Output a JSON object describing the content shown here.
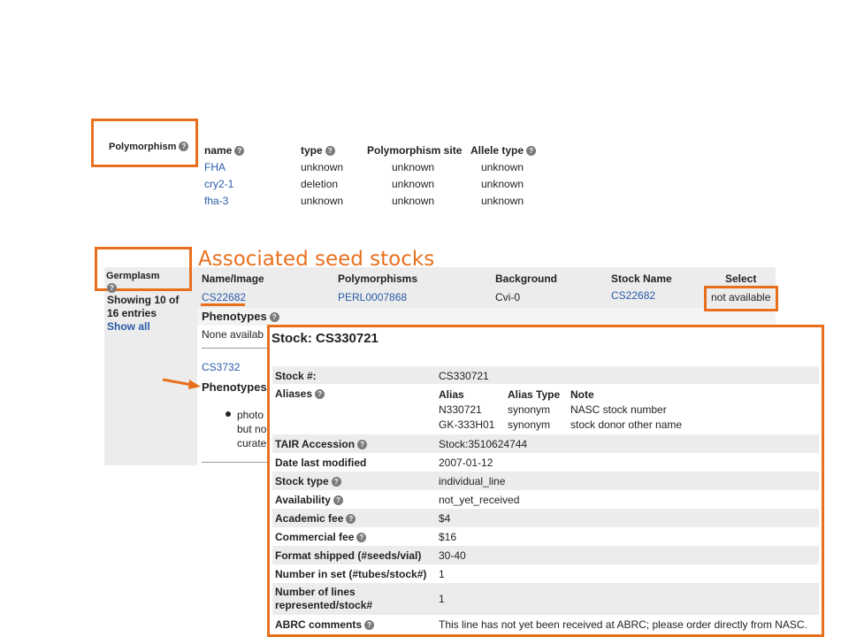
{
  "polymorphism": {
    "section_label": "Polymorphism",
    "headers": [
      "name",
      "type",
      "Polymorphism site",
      "Allele type"
    ],
    "rows": [
      {
        "name": "FHA",
        "type": "unknown",
        "site": "unknown",
        "allele": "unknown"
      },
      {
        "name": "cry2-1",
        "type": "deletion",
        "site": "unknown",
        "allele": "unknown"
      },
      {
        "name": "fha-3",
        "type": "unknown",
        "site": "unknown",
        "allele": "unknown"
      }
    ]
  },
  "annotation": {
    "associated_label": "Associated seed stocks"
  },
  "germplasm": {
    "section_label": "Germplasm",
    "showing_text": "Showing 10 of 16 entries",
    "show_all": "Show all",
    "headers": [
      "Name/Image",
      "Polymorphisms",
      "Background",
      "Stock Name",
      "Select"
    ],
    "row1": {
      "name": "CS22682",
      "polymorphism": "PERL0007868",
      "background": "Cvi-0",
      "stock_name": "CS22682",
      "select": "not available"
    },
    "phenotypes_label": "Phenotypes",
    "none_text": "None availab",
    "row2_name": "CS3732",
    "phenotypes_label2": "Phenotypes",
    "bullet_lines": [
      "photo",
      "but no",
      "curate"
    ]
  },
  "stock_popup": {
    "title": "Stock: CS330721",
    "rows": [
      {
        "label": "Stock #:",
        "value": "CS330721"
      },
      {
        "label": "Aliases",
        "value": ""
      },
      {
        "label": "TAIR Accession",
        "value": "Stock:3510624744"
      },
      {
        "label": "Date last modified",
        "value": "2007-01-12"
      },
      {
        "label": "Stock type",
        "value": "individual_line"
      },
      {
        "label": "Availability",
        "value": "not_yet_received"
      },
      {
        "label": "Academic fee",
        "value": "$4"
      },
      {
        "label": "Commercial fee",
        "value": "$16"
      },
      {
        "label": "Format shipped (#seeds/vial)",
        "value": "30-40"
      },
      {
        "label": "Number in set (#tubes/stock#)",
        "value": "1"
      },
      {
        "label": "Number of lines represented/stock#",
        "value": "1"
      },
      {
        "label": "ABRC comments",
        "value": "This line has not yet been received at ABRC; please order directly from NASC."
      }
    ],
    "alias_headers": [
      "Alias",
      "Alias Type",
      "Note"
    ],
    "aliases": [
      {
        "alias": "N330721",
        "type": "synonym",
        "note": "NASC stock number"
      },
      {
        "alias": "GK-333H01",
        "type": "synonym",
        "note": "stock donor other name"
      }
    ]
  },
  "colors": {
    "highlight": "#e8701d",
    "link": "#2a5aa8"
  }
}
